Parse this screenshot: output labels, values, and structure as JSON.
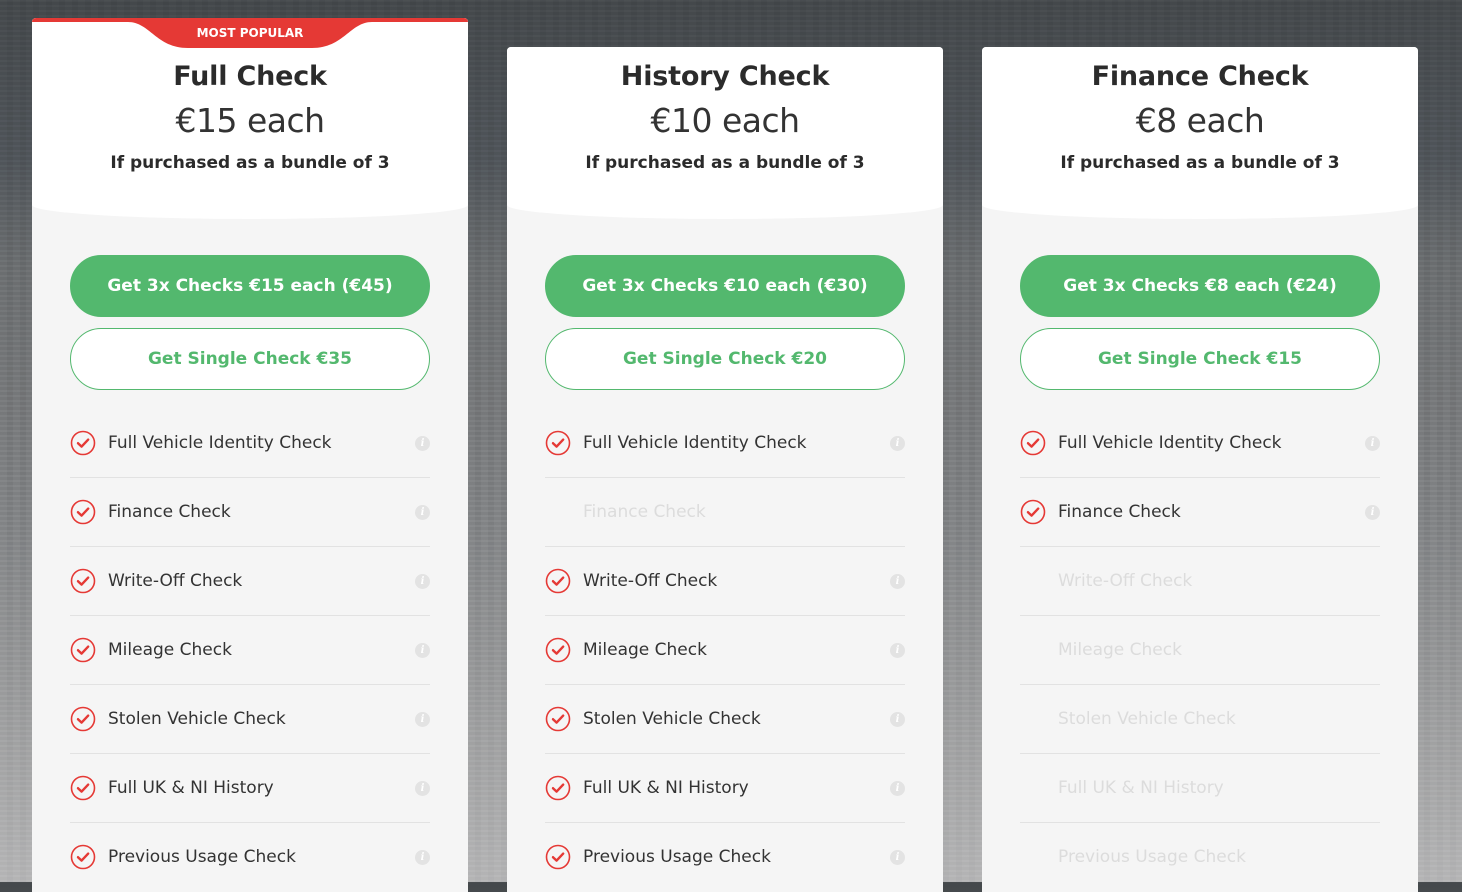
{
  "colors": {
    "accent_green": "#53b86e",
    "badge_red": "#e53935",
    "check_red": "#e53935"
  },
  "cards": [
    {
      "badge": "MOST POPULAR",
      "title": "Full Check",
      "price": "€15 each",
      "note": "If purchased as a bundle of 3",
      "bundle_button": "Get 3x Checks €15 each (€45)",
      "single_button": "Get Single Check €35",
      "features": [
        {
          "label": "Full Vehicle Identity Check",
          "included": true,
          "icon": "check-circle-icon",
          "info_icon": "info-icon"
        },
        {
          "label": "Finance Check",
          "included": true,
          "icon": "check-circle-icon",
          "info_icon": "info-icon"
        },
        {
          "label": "Write-Off Check",
          "included": true,
          "icon": "check-circle-icon",
          "info_icon": "info-icon"
        },
        {
          "label": "Mileage Check",
          "included": true,
          "icon": "check-circle-icon",
          "info_icon": "info-icon"
        },
        {
          "label": "Stolen Vehicle Check",
          "included": true,
          "icon": "check-circle-icon",
          "info_icon": "info-icon"
        },
        {
          "label": "Full UK & NI History",
          "included": true,
          "icon": "check-circle-icon",
          "info_icon": "info-icon"
        },
        {
          "label": "Previous Usage Check",
          "included": true,
          "icon": "check-circle-icon",
          "info_icon": "info-icon"
        }
      ]
    },
    {
      "badge": null,
      "title": "History Check",
      "price": "€10 each",
      "note": "If purchased as a bundle of 3",
      "bundle_button": "Get 3x Checks €10 each (€30)",
      "single_button": "Get Single Check €20",
      "features": [
        {
          "label": "Full Vehicle Identity Check",
          "included": true,
          "icon": "check-circle-icon",
          "info_icon": "info-icon"
        },
        {
          "label": "Finance Check",
          "included": false,
          "icon": "check-circle-icon",
          "info_icon": "info-icon"
        },
        {
          "label": "Write-Off Check",
          "included": true,
          "icon": "check-circle-icon",
          "info_icon": "info-icon"
        },
        {
          "label": "Mileage Check",
          "included": true,
          "icon": "check-circle-icon",
          "info_icon": "info-icon"
        },
        {
          "label": "Stolen Vehicle Check",
          "included": true,
          "icon": "check-circle-icon",
          "info_icon": "info-icon"
        },
        {
          "label": "Full UK & NI History",
          "included": true,
          "icon": "check-circle-icon",
          "info_icon": "info-icon"
        },
        {
          "label": "Previous Usage Check",
          "included": true,
          "icon": "check-circle-icon",
          "info_icon": "info-icon"
        }
      ]
    },
    {
      "badge": null,
      "title": "Finance Check",
      "price": "€8 each",
      "note": "If purchased as a bundle of 3",
      "bundle_button": "Get 3x Checks €8 each (€24)",
      "single_button": "Get Single Check €15",
      "features": [
        {
          "label": "Full Vehicle Identity Check",
          "included": true,
          "icon": "check-circle-icon",
          "info_icon": "info-icon"
        },
        {
          "label": "Finance Check",
          "included": true,
          "icon": "check-circle-icon",
          "info_icon": "info-icon"
        },
        {
          "label": "Write-Off Check",
          "included": false,
          "icon": "check-circle-icon",
          "info_icon": "info-icon"
        },
        {
          "label": "Mileage Check",
          "included": false,
          "icon": "check-circle-icon",
          "info_icon": "info-icon"
        },
        {
          "label": "Stolen Vehicle Check",
          "included": false,
          "icon": "check-circle-icon",
          "info_icon": "info-icon"
        },
        {
          "label": "Full UK & NI History",
          "included": false,
          "icon": "check-circle-icon",
          "info_icon": "info-icon"
        },
        {
          "label": "Previous Usage Check",
          "included": false,
          "icon": "check-circle-icon",
          "info_icon": "info-icon"
        }
      ]
    }
  ]
}
